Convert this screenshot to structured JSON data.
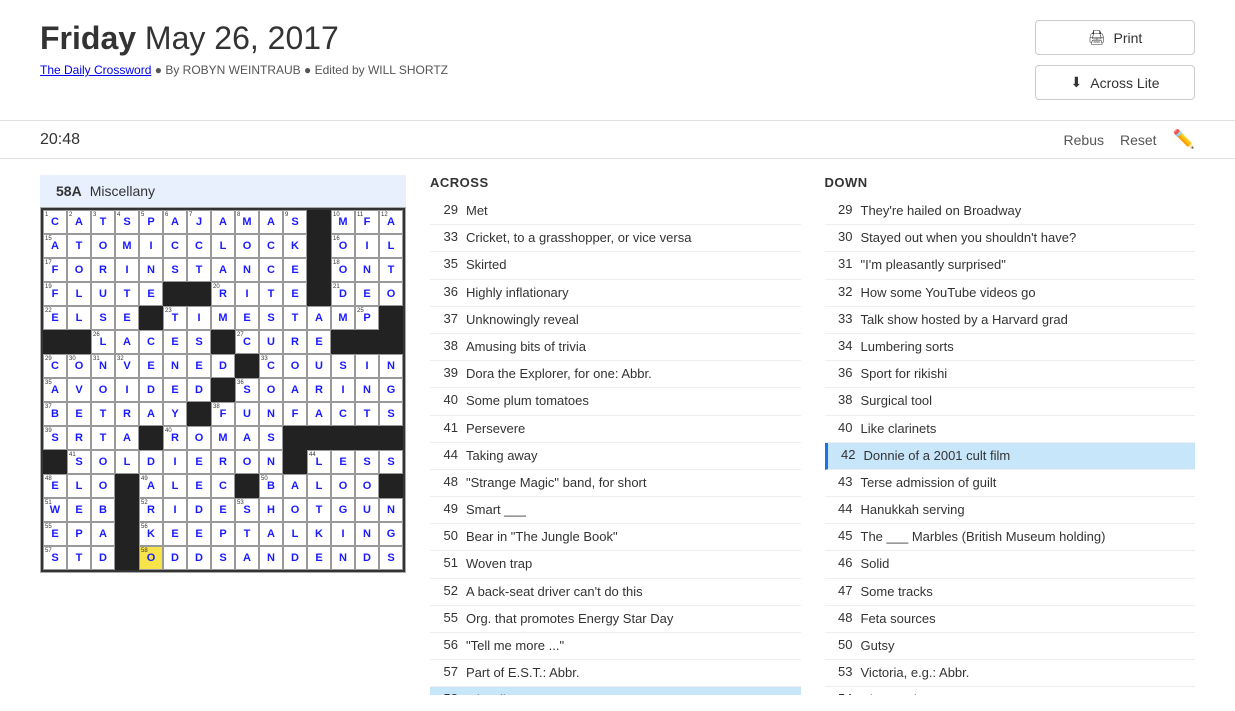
{
  "header": {
    "title_bold": "Friday",
    "title_rest": " May 26, 2017",
    "meta_link": "The Daily Crossword",
    "meta_author": "By ROBYN WEINTRAUB",
    "meta_editor": "Edited by WILL SHORTZ",
    "print_label": "Print",
    "across_lite_label": "Across Lite"
  },
  "toolbar": {
    "timer": "20:48",
    "rebus_label": "Rebus",
    "reset_label": "Reset"
  },
  "active_clue": {
    "number": "58A",
    "text": "Miscellany"
  },
  "clues": {
    "across_header": "ACROSS",
    "down_header": "DOWN",
    "across": [
      {
        "num": "29",
        "text": "Met"
      },
      {
        "num": "33",
        "text": "Cricket, to a grasshopper, or vice versa"
      },
      {
        "num": "35",
        "text": "Skirted"
      },
      {
        "num": "36",
        "text": "Highly inflationary"
      },
      {
        "num": "37",
        "text": "Unknowingly reveal"
      },
      {
        "num": "38",
        "text": "Amusing bits of trivia"
      },
      {
        "num": "39",
        "text": "Dora the Explorer, for one: Abbr."
      },
      {
        "num": "40",
        "text": "Some plum tomatoes"
      },
      {
        "num": "41",
        "text": "Persevere"
      },
      {
        "num": "44",
        "text": "Taking away"
      },
      {
        "num": "48",
        "text": "\"Strange Magic\" band, for short"
      },
      {
        "num": "49",
        "text": "Smart ___"
      },
      {
        "num": "50",
        "text": "Bear in \"The Jungle Book\""
      },
      {
        "num": "51",
        "text": "Woven trap"
      },
      {
        "num": "52",
        "text": "A back-seat driver can't do this"
      },
      {
        "num": "55",
        "text": "Org. that promotes Energy Star Day"
      },
      {
        "num": "56",
        "text": "\"Tell me more ...\""
      },
      {
        "num": "57",
        "text": "Part of E.S.T.: Abbr."
      },
      {
        "num": "58",
        "text": "Miscellany",
        "active": true
      }
    ],
    "down": [
      {
        "num": "29",
        "text": "They're hailed on Broadway"
      },
      {
        "num": "30",
        "text": "Stayed out when you shouldn't have?"
      },
      {
        "num": "31",
        "text": "\"I'm pleasantly surprised\""
      },
      {
        "num": "32",
        "text": "How some YouTube videos go"
      },
      {
        "num": "33",
        "text": "Talk show hosted by a Harvard grad"
      },
      {
        "num": "34",
        "text": "Lumbering sorts"
      },
      {
        "num": "36",
        "text": "Sport for rikishi"
      },
      {
        "num": "38",
        "text": "Surgical tool"
      },
      {
        "num": "40",
        "text": "Like clarinets"
      },
      {
        "num": "42",
        "text": "Donnie of a 2001 cult film",
        "highlight": true
      },
      {
        "num": "43",
        "text": "Terse admission of guilt"
      },
      {
        "num": "44",
        "text": "Hanukkah serving"
      },
      {
        "num": "45",
        "text": "The ___ Marbles (British Museum holding)"
      },
      {
        "num": "46",
        "text": "Solid"
      },
      {
        "num": "47",
        "text": "Some tracks"
      },
      {
        "num": "48",
        "text": "Feta sources"
      },
      {
        "num": "50",
        "text": "Gutsy"
      },
      {
        "num": "53",
        "text": "Victoria, e.g.: Abbr."
      },
      {
        "num": "54",
        "text": "River or dynasty name"
      }
    ]
  }
}
